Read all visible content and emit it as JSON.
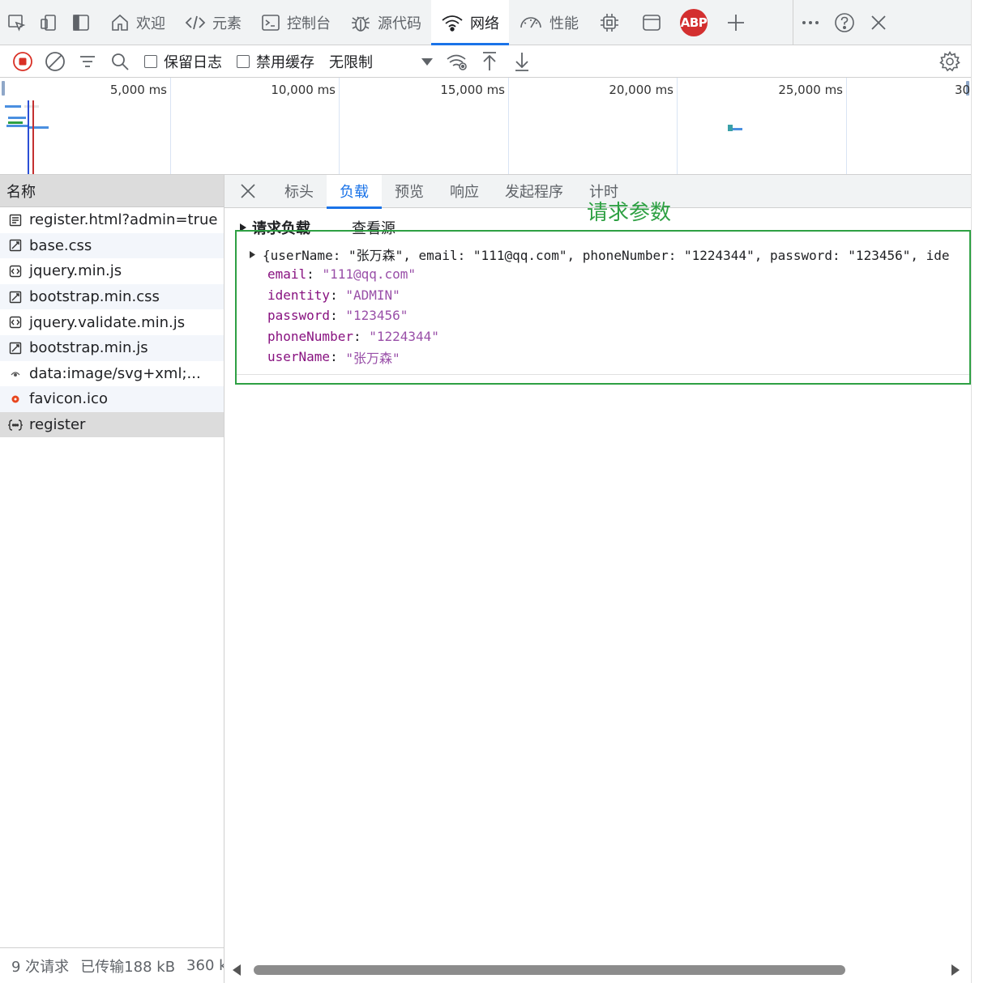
{
  "tabs": [
    {
      "label": "欢迎",
      "icon": "home-icon",
      "active": false
    },
    {
      "label": "元素",
      "icon": "code-icon",
      "active": false
    },
    {
      "label": "控制台",
      "icon": "console-icon",
      "active": false
    },
    {
      "label": "源代码",
      "icon": "bug-icon",
      "active": false
    },
    {
      "label": "网络",
      "icon": "wifi-icon",
      "active": true
    },
    {
      "label": "性能",
      "icon": "gauge-icon",
      "active": false
    }
  ],
  "abp_label": "ABP",
  "toolbar": {
    "preserve_log": "保留日志",
    "disable_cache": "禁用缓存",
    "throttle": "无限制"
  },
  "overview": {
    "ticks": [
      "5,000 ms",
      "10,000 ms",
      "15,000 ms",
      "20,000 ms",
      "25,000 ms",
      "30"
    ]
  },
  "requests": {
    "header": "名称",
    "items": [
      {
        "name": "register.html?admin=true",
        "icon": "document-icon"
      },
      {
        "name": "base.css",
        "icon": "stylesheet-icon"
      },
      {
        "name": "jquery.min.js",
        "icon": "script-icon"
      },
      {
        "name": "bootstrap.min.css",
        "icon": "stylesheet-icon"
      },
      {
        "name": "jquery.validate.min.js",
        "icon": "script-icon"
      },
      {
        "name": "bootstrap.min.js",
        "icon": "stylesheet-icon"
      },
      {
        "name": "data:image/svg+xml;...",
        "icon": "image-icon"
      },
      {
        "name": "favicon.ico",
        "icon": "favicon-icon"
      },
      {
        "name": "register",
        "icon": "fetch-icon"
      }
    ],
    "selected_index": 8
  },
  "status": {
    "requests": "9 次请求",
    "transferred": "已传输188 kB",
    "resources": "360 k"
  },
  "detail_tabs": [
    "标头",
    "负载",
    "预览",
    "响应",
    "发起程序",
    "计时"
  ],
  "detail_active": "负载",
  "payload": {
    "section_title": "请求负载",
    "view_source": "查看源",
    "annotation": "请求参数",
    "summary": "{userName: \"张万森\", email: \"111@qq.com\", phoneNumber: \"1224344\", password: \"123456\", ide",
    "props": [
      {
        "key": "email",
        "value": "\"111@qq.com\""
      },
      {
        "key": "identity",
        "value": "\"ADMIN\""
      },
      {
        "key": "password",
        "value": "\"123456\""
      },
      {
        "key": "phoneNumber",
        "value": "\"1224344\""
      },
      {
        "key": "userName",
        "value": "\"张万森\""
      }
    ]
  }
}
